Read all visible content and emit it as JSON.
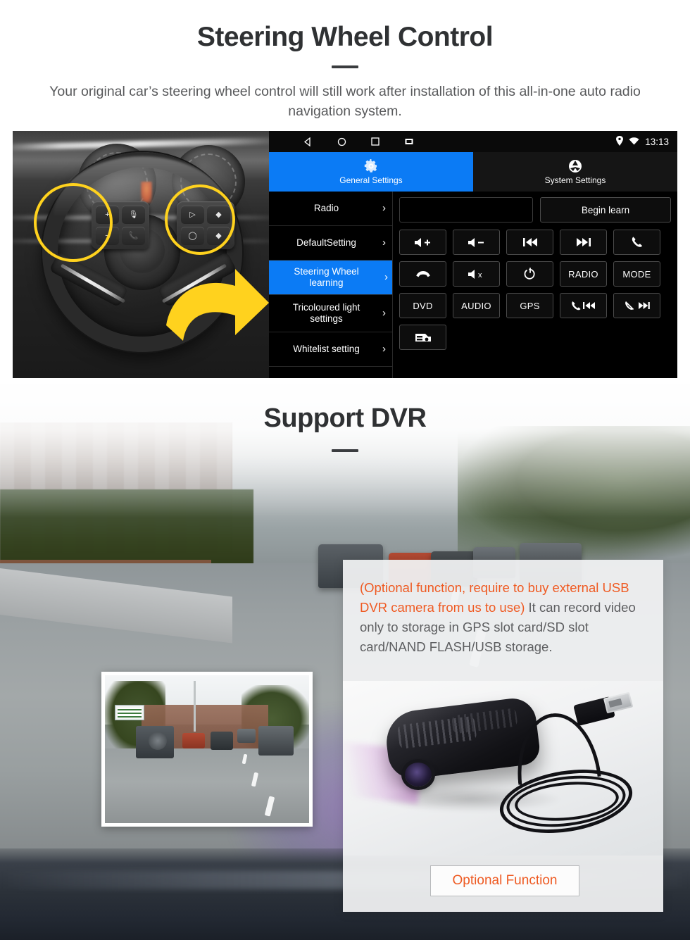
{
  "section1": {
    "title": "Steering Wheel Control",
    "subtitle": "Your original car’s steering wheel control will still work after installation of this all-in-one auto radio navigation system.",
    "photo_alt": "steering-wheel-with-control-buttons"
  },
  "head_unit": {
    "status_bar": {
      "nav_back_icon": "triangle-back-icon",
      "nav_home_icon": "circle-home-icon",
      "nav_recents_icon": "square-recents-icon",
      "nav_screenshot_icon": "screenshot-icon",
      "gps_icon": "location-pin-icon",
      "wifi_icon": "wifi-icon",
      "time": "13:13"
    },
    "tabs": [
      {
        "label": "General Settings",
        "icon": "gear-icon",
        "active": true
      },
      {
        "label": "System Settings",
        "icon": "system-settings-icon",
        "active": false
      }
    ],
    "menu": [
      {
        "label": "Radio",
        "active": false,
        "chevron": "›"
      },
      {
        "label": "DefaultSetting",
        "active": false,
        "chevron": "›"
      },
      {
        "label": "Steering Wheel learning",
        "active": true,
        "chevron": "›"
      },
      {
        "label": "Tricoloured light settings",
        "active": false,
        "chevron": "›"
      },
      {
        "label": "Whitelist setting",
        "active": false,
        "chevron": "›"
      }
    ],
    "learn_field_value": "",
    "learn_field_placeholder": "",
    "begin_learn_label": "Begin learn",
    "keys": [
      {
        "label": "",
        "icon": "volume-up-icon"
      },
      {
        "label": "",
        "icon": "volume-down-icon"
      },
      {
        "label": "",
        "icon": "previous-track-icon"
      },
      {
        "label": "",
        "icon": "next-track-icon"
      },
      {
        "label": "",
        "icon": "call-answer-icon"
      },
      {
        "label": "",
        "icon": "call-hangup-icon"
      },
      {
        "label": "",
        "icon": "mute-icon"
      },
      {
        "label": "",
        "icon": "power-icon"
      },
      {
        "label": "RADIO",
        "icon": ""
      },
      {
        "label": "MODE",
        "icon": ""
      },
      {
        "label": "DVD",
        "icon": ""
      },
      {
        "label": "AUDIO",
        "icon": ""
      },
      {
        "label": "GPS",
        "icon": ""
      },
      {
        "label": "",
        "icon": "call-previous-icon"
      },
      {
        "label": "",
        "icon": "hangup-next-icon"
      },
      {
        "label": "",
        "icon": "car-front-icon"
      }
    ]
  },
  "section2": {
    "title": "Support DVR",
    "card": {
      "highlight_text": "(Optional function, require to buy external USB DVR camera from us to use)",
      "body_text": "It can record video only to storage in GPS slot card/SD slot card/NAND FLASH/USB storage.",
      "highlight_color": "#ef5a22",
      "button_label": "Optional Function",
      "device_alt": "usb-dvr-camera-with-cable"
    },
    "inset_alt": "dashcam-recording-preview"
  }
}
